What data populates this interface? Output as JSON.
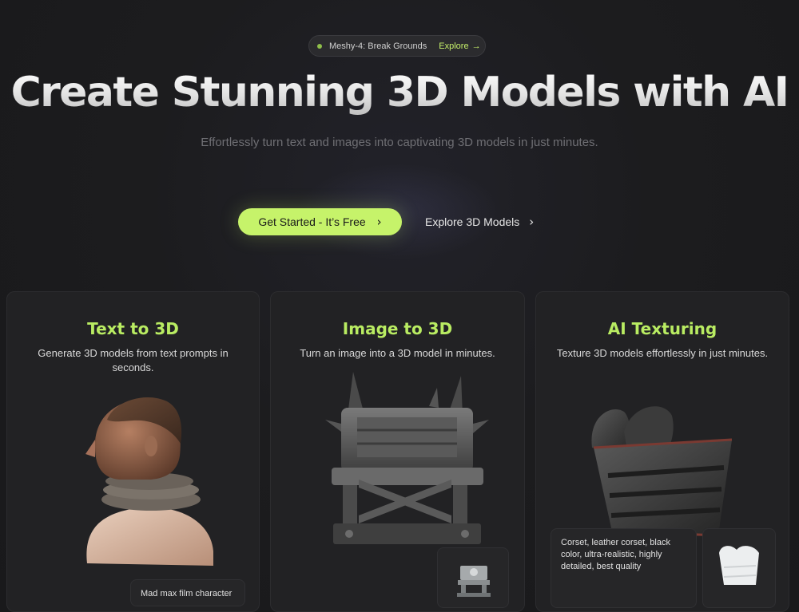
{
  "announcement": {
    "text": "Meshy-4: Break Grounds",
    "explore_label": "Explore",
    "arrow": "→"
  },
  "hero": {
    "title": "Create Stunning 3D Models with AI",
    "subtitle": "Effortlessly turn text and images into captivating 3D models in just minutes."
  },
  "cta": {
    "primary_label": "Get Started - It’s Free",
    "secondary_label": "Explore 3D Models",
    "chevron": "›"
  },
  "features": [
    {
      "title": "Text to 3D",
      "description": "Generate 3D models from text prompts in seconds.",
      "caption": "Mad max film character"
    },
    {
      "title": "Image to 3D",
      "description": "Turn an image into a 3D model in minutes."
    },
    {
      "title": "AI Texturing",
      "description": "Texture 3D models effortlessly in just minutes.",
      "caption": "Corset, leather corset, black color, ultra-realistic, highly detailed, best quality"
    }
  ],
  "colors": {
    "background": "#1c1c1e",
    "accent": "#c6f36a",
    "feature_title": "#b9ec62",
    "card": "#222224"
  },
  "icons": {
    "status_dot": "status-dot-icon",
    "arrow_right": "arrow-right-icon",
    "chevron_right": "chevron-right-icon"
  }
}
